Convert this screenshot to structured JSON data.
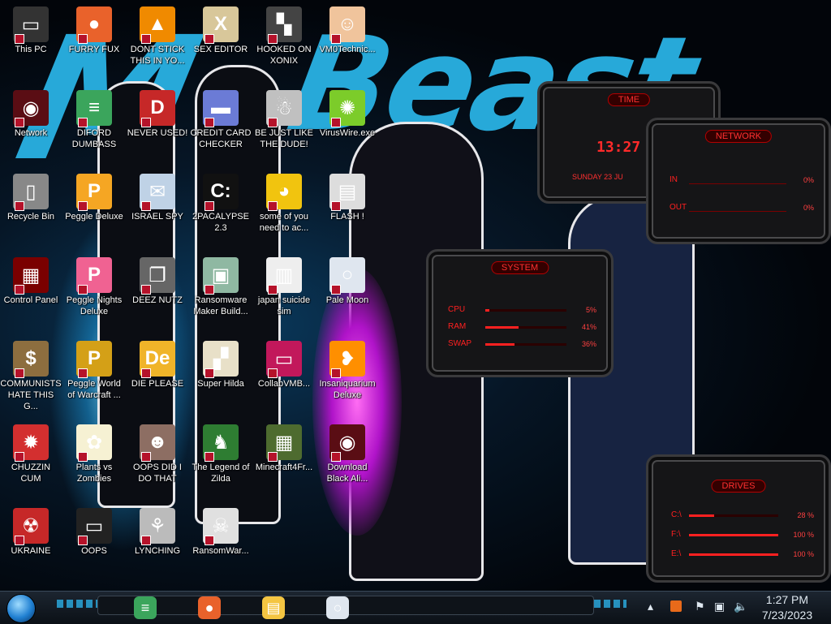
{
  "desktop": {
    "icons": [
      {
        "label": "This PC",
        "icon": "computer-icon"
      },
      {
        "label": "FURRY FUX",
        "icon": "firefox-icon"
      },
      {
        "label": "DONT STICK THIS IN YO...",
        "icon": "vlc-icon"
      },
      {
        "label": "SEX EDITOR",
        "icon": "hex-editor-icon"
      },
      {
        "label": "HOOKED ON XONIX",
        "icon": "xonix-icon"
      },
      {
        "label": "VM0Technic...",
        "icon": "doctor-icon"
      },
      {
        "label": "Network",
        "icon": "network-icon"
      },
      {
        "label": "DIFORD DUMBASS",
        "icon": "discord-icon"
      },
      {
        "label": "NEVER USED!",
        "icon": "devcpp-icon"
      },
      {
        "label": "CREDIT CARD CHECKER",
        "icon": "credit-card-icon"
      },
      {
        "label": "BE JUST LIKE THE DUDE!",
        "icon": "santa-icon"
      },
      {
        "label": "VirusWire.exe",
        "icon": "lime-icon"
      },
      {
        "label": "Recycle Bin",
        "icon": "recycle-bin-icon"
      },
      {
        "label": "Peggle Deluxe",
        "icon": "peggle-icon"
      },
      {
        "label": "ISRAEL SPY",
        "icon": "spy-icon"
      },
      {
        "label": "2PACALYPSE 2.3",
        "icon": "terminal-icon"
      },
      {
        "label": "some of you need to ac...",
        "icon": "beaver-icon"
      },
      {
        "label": "FLASH !",
        "icon": "flash-icon"
      },
      {
        "label": "Control Panel",
        "icon": "control-panel-icon"
      },
      {
        "label": "Peggle Nights Deluxe",
        "icon": "peggle-nights-icon"
      },
      {
        "label": "DEEZ NUTZ",
        "icon": "windows-stack-icon"
      },
      {
        "label": "Ransomware Maker Build...",
        "icon": "window-app-icon"
      },
      {
        "label": "japan suicide sim",
        "icon": "document-icon"
      },
      {
        "label": "Pale Moon",
        "icon": "pale-moon-icon"
      },
      {
        "label": "COMMUNISTS HATE THIS G...",
        "icon": "money-bag-icon"
      },
      {
        "label": "Peggle World of Warcraft ...",
        "icon": "peggle-wow-icon"
      },
      {
        "label": "DIE PLEASE",
        "icon": "de-icon"
      },
      {
        "label": "Super Hilda",
        "icon": "pixel-dog-icon"
      },
      {
        "label": "CollabVMB...",
        "icon": "collabvm-icon"
      },
      {
        "label": "Insaniquarium Deluxe",
        "icon": "fish-icon"
      },
      {
        "label": "CHUZZIN CUM",
        "icon": "chuzzle-icon"
      },
      {
        "label": "Plants vs Zombies",
        "icon": "flower-icon"
      },
      {
        "label": "OOPS DID I DO THAT",
        "icon": "portrait-icon"
      },
      {
        "label": "The Legend of Zilda",
        "icon": "zelda-icon"
      },
      {
        "label": "Minecraft4Fr...",
        "icon": "minecraft-icon"
      },
      {
        "label": "Download Black Ali...",
        "icon": "alienware-icon"
      },
      {
        "label": "UKRAINE",
        "icon": "radiation-icon"
      },
      {
        "label": "OOPS",
        "icon": "monitor-icon"
      },
      {
        "label": "LYNCHING",
        "icon": "tree-icon"
      },
      {
        "label": "RansomWar...",
        "icon": "skull-icon"
      }
    ]
  },
  "wallpaper": {
    "title_text": "Mr Beast"
  },
  "gadgets": {
    "time": {
      "title": "TIME",
      "clock": "13:27",
      "date": "SUNDAY 23 JU"
    },
    "network": {
      "title": "NETWORK",
      "in_label": "IN",
      "in_value": "0%",
      "out_label": "OUT",
      "out_value": "0%"
    },
    "system": {
      "title": "SYSTEM",
      "rows": [
        {
          "label": "CPU",
          "value": "5%",
          "fill": 0.05
        },
        {
          "label": "RAM",
          "value": "41%",
          "fill": 0.41
        },
        {
          "label": "SWAP",
          "value": "36%",
          "fill": 0.36
        }
      ]
    },
    "drives": {
      "title": "DRIVES",
      "rows": [
        {
          "label": "C:\\",
          "value": "28 %",
          "fill": 0.28
        },
        {
          "label": "F:\\",
          "value": "100 %",
          "fill": 1.0
        },
        {
          "label": "E:\\",
          "value": "100 %",
          "fill": 1.0
        }
      ]
    }
  },
  "taskbar": {
    "pinned": [
      {
        "icon": "discord-icon"
      },
      {
        "icon": "firefox-icon"
      },
      {
        "icon": "file-explorer-icon"
      },
      {
        "icon": "pale-moon-icon"
      }
    ],
    "tray_icons": [
      "chevron-up-icon",
      "language-icon",
      "flag-icon",
      "network-tray-icon",
      "volume-icon"
    ],
    "clock_time": "1:27 PM",
    "clock_date": "7/23/2023"
  }
}
